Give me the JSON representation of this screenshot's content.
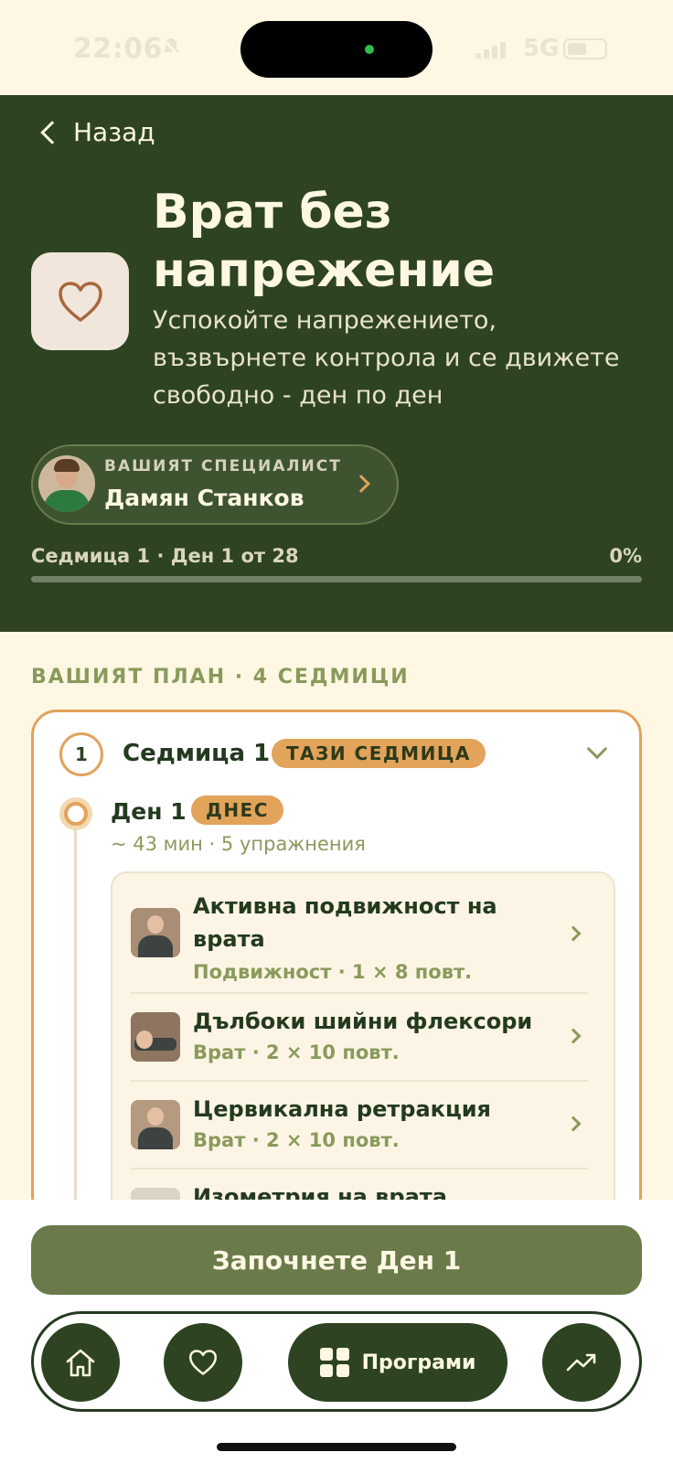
{
  "status_bar": {
    "time": "22:06",
    "network": "5G"
  },
  "header": {
    "back_label": "Назад",
    "title": "Врат без напрежение",
    "subtitle": "Успокойте напрежението, възвърнете контрола и се движете свободно - ден по ден",
    "specialist_label": "ВАШИЯТ СПЕЦИАЛИСТ",
    "specialist_name": "Дамян Станков",
    "progress_label": "Седмица 1 · Ден 1 от 28",
    "progress_pct_text": "0%",
    "progress_value": 0
  },
  "plan": {
    "title": "ВАШИЯТ ПЛАН · 4 СЕДМИЦИ",
    "week": {
      "number": "1",
      "title": "Седмица 1",
      "badge": "ТАЗИ СЕДМИЦА",
      "day": {
        "title": "Ден 1",
        "badge": "ДНЕС",
        "meta": "~ 43 мин · 5 упражнения",
        "exercises": [
          {
            "name": "Активна подвижност на врата",
            "meta": "Подвижност · 1 × 8 повт."
          },
          {
            "name": "Дълбоки шийни флексори",
            "meta": "Врат · 2 × 10 повт."
          },
          {
            "name": "Цервикална ретракция",
            "meta": "Врат · 2 × 10 повт."
          },
          {
            "name": "Изометрия на врата",
            "meta": ""
          }
        ]
      }
    }
  },
  "bottom": {
    "start_button": "Започнете Ден 1",
    "tabs": {
      "programs_label": "Програми"
    }
  },
  "colors": {
    "dark_green": "#2d4322",
    "accent": "#e2a35b",
    "olive": "#6b7a4a",
    "cream": "#fdf7e3"
  }
}
